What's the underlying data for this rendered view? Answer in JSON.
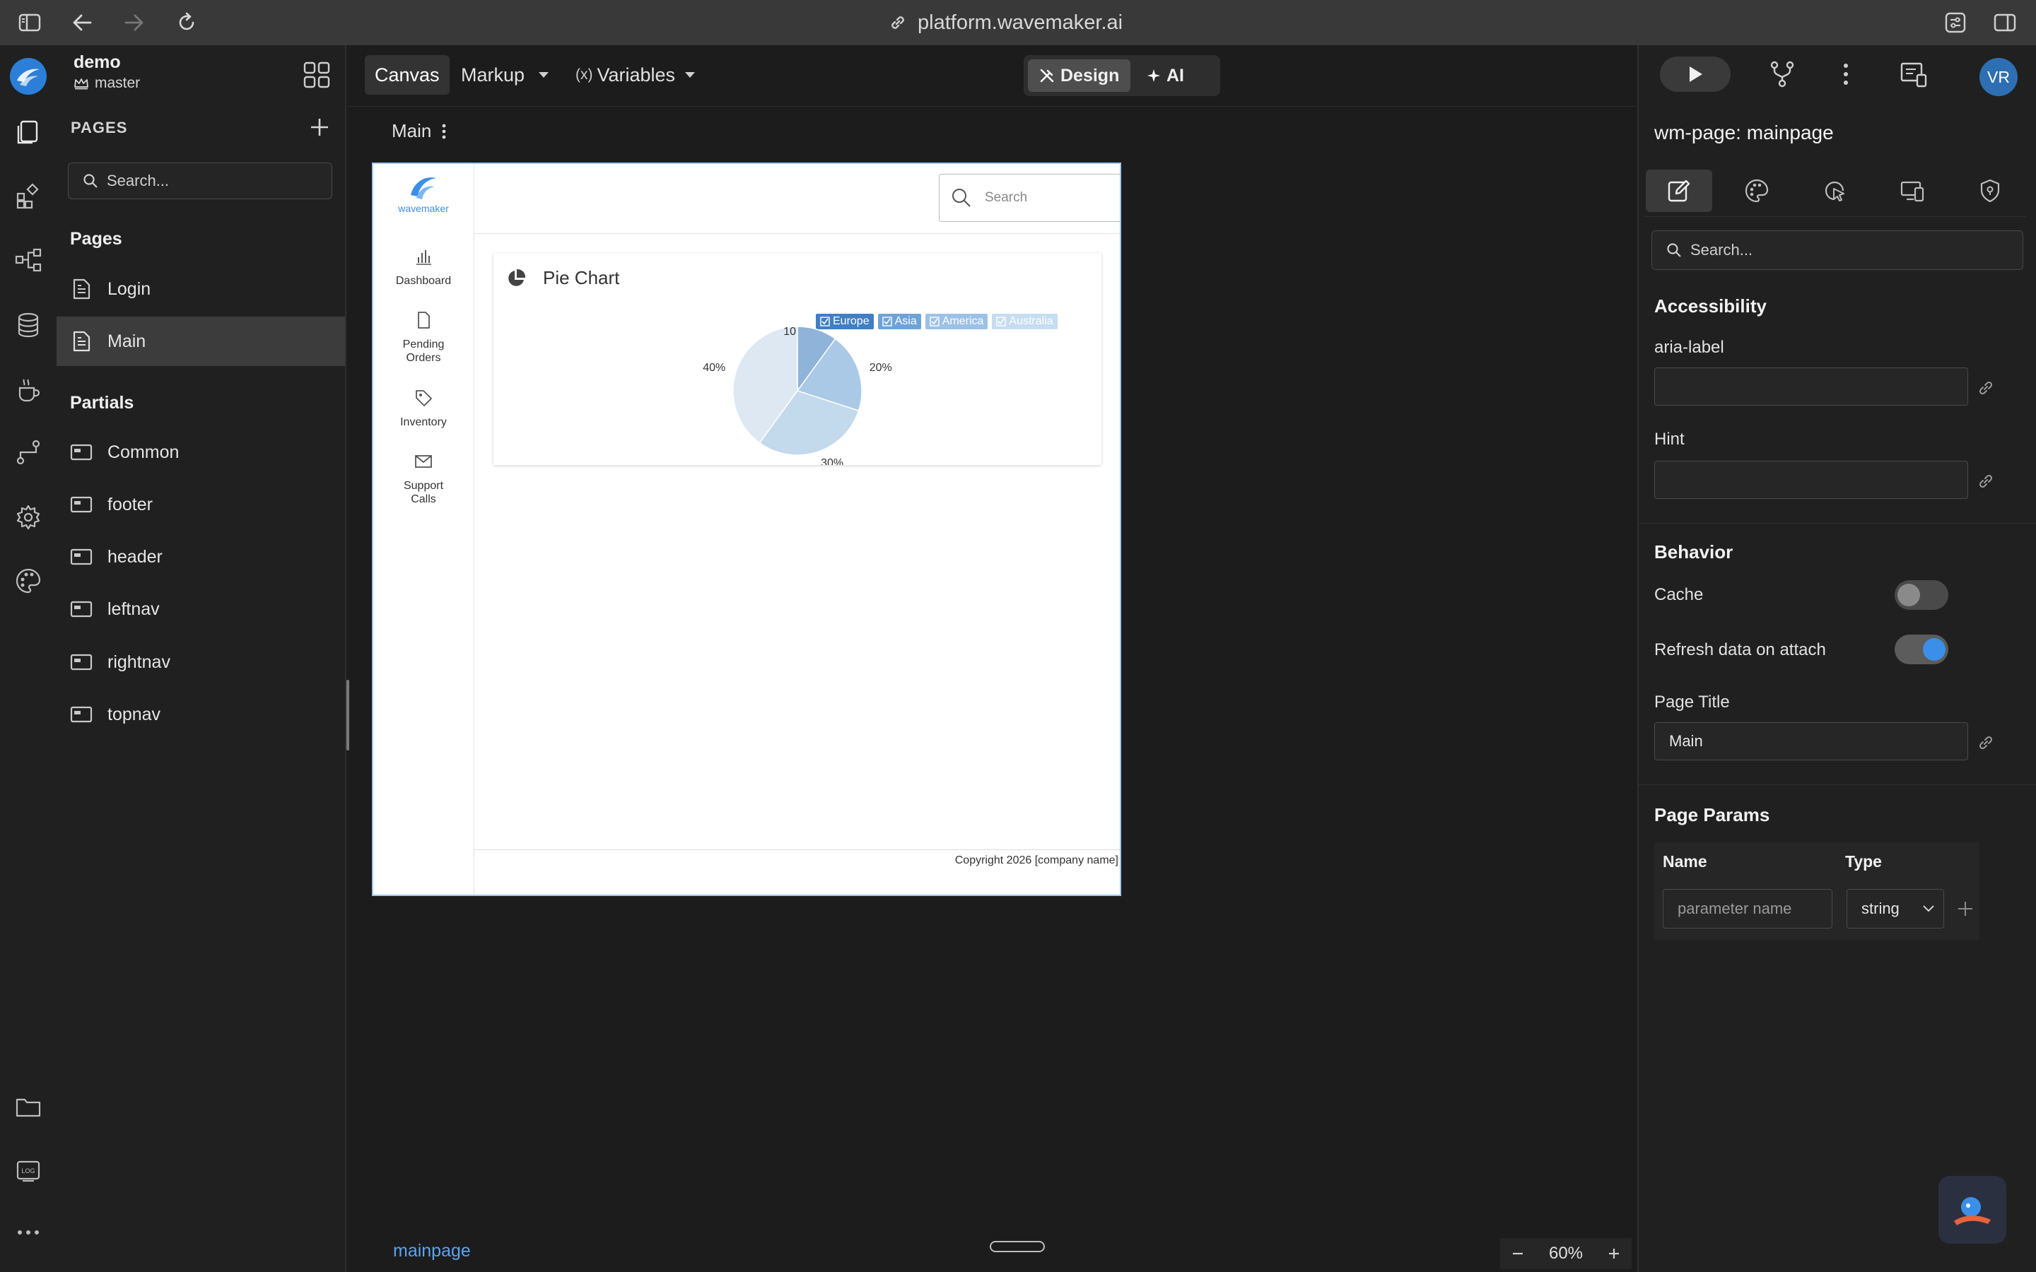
{
  "browser": {
    "url": "platform.wavemaker.ai"
  },
  "project": {
    "name": "demo",
    "branch": "master"
  },
  "pages_panel": {
    "heading": "PAGES",
    "search_placeholder": "Search...",
    "pages_title": "Pages",
    "pages": [
      {
        "label": "Login"
      },
      {
        "label": "Main"
      }
    ],
    "partials_title": "Partials",
    "partials": [
      {
        "label": "Common"
      },
      {
        "label": "footer"
      },
      {
        "label": "header"
      },
      {
        "label": "leftnav"
      },
      {
        "label": "rightnav"
      },
      {
        "label": "topnav"
      }
    ]
  },
  "toolbar": {
    "canvas": "Canvas",
    "markup": "Markup",
    "variables": "Variables",
    "variables_prefix": "(x)",
    "design": "Design",
    "ai": "AI"
  },
  "canvas": {
    "breadcrumb": "Main",
    "page_link": "mainpage",
    "zoom": "60%"
  },
  "preview": {
    "logo_text": "wavemaker",
    "nav": [
      {
        "label": "Dashboard",
        "icon": "bar-chart-icon"
      },
      {
        "label": "Pending Orders",
        "icon": "file-icon"
      },
      {
        "label": "Inventory",
        "icon": "tag-icon"
      },
      {
        "label": "Support Calls",
        "icon": "mail-icon"
      }
    ],
    "search_placeholder": "Search",
    "card_title": "Pie Chart",
    "footer": "Copyright 2026 [company name]"
  },
  "chart_data": {
    "type": "pie",
    "categories": [
      "Europe",
      "Asia",
      "America",
      "Australia"
    ],
    "values": [
      10,
      20,
      30,
      40
    ],
    "labels": [
      "10",
      "20%",
      "30%",
      "40%"
    ],
    "colors": [
      "#8fb3d9",
      "#a9c9e6",
      "#c3d9ec",
      "#dde8f3"
    ],
    "legend_placement": "top-right"
  },
  "right_panel": {
    "avatar": "VR",
    "title": "wm-page: mainpage",
    "search_placeholder": "Search...",
    "accessibility": "Accessibility",
    "aria_label": "aria-label",
    "hint": "Hint",
    "behavior": "Behavior",
    "cache": "Cache",
    "cache_on": false,
    "refresh": "Refresh data on attach",
    "refresh_on": true,
    "page_title_label": "Page Title",
    "page_title_value": "Main",
    "page_params": "Page Params",
    "param_name_head": "Name",
    "param_type_head": "Type",
    "param_name_placeholder": "parameter name",
    "param_type_value": "string"
  },
  "colors": {
    "accent": "#3b8fe8",
    "link": "#5aa4f4"
  }
}
